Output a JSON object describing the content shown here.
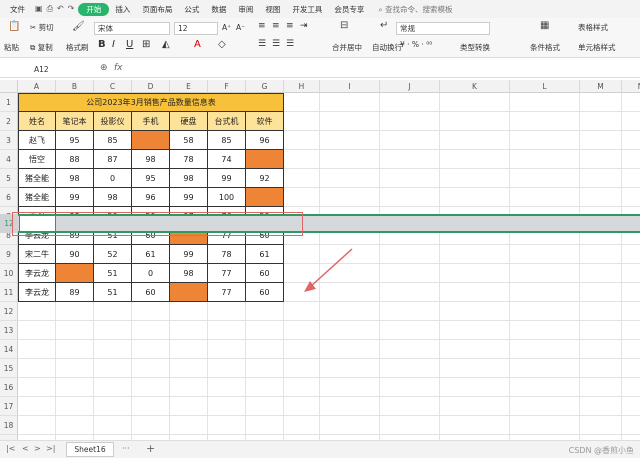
{
  "menu": {
    "file": "文件",
    "tabs": [
      "开始",
      "插入",
      "页面布局",
      "公式",
      "数据",
      "审阅",
      "视图",
      "开发工具",
      "会员专享"
    ],
    "active_index": 0,
    "search": "查找命令、搜索模板"
  },
  "ribbon": {
    "paste": "粘贴",
    "cut": "剪切",
    "copy": "复制",
    "format_painter": "格式刷",
    "font_name": "宋体",
    "font_size": "12",
    "merge_center": "合并居中",
    "wrap_text": "自动换行",
    "number_format": "常规",
    "type_convert": "类型转换",
    "conditional_format": "条件格式",
    "table_style": "表格样式",
    "cell_style": "单元格样式"
  },
  "formula_bar": {
    "name_box": "A12",
    "fx": "fx",
    "value": ""
  },
  "columns": [
    "A",
    "B",
    "C",
    "D",
    "E",
    "F",
    "G",
    "H",
    "I",
    "J",
    "K",
    "L",
    "M",
    "N",
    "O"
  ],
  "rows": [
    "1",
    "2",
    "3",
    "4",
    "5",
    "6",
    "7",
    "8",
    "9",
    "10",
    "11",
    "12",
    "13",
    "14",
    "15",
    "16",
    "17",
    "18",
    "19",
    "20"
  ],
  "table": {
    "title": "公司2023年3月销售产品数量信息表",
    "headers": [
      "姓名",
      "笔记本",
      "投影仪",
      "手机",
      "硬盘",
      "台式机",
      "软件"
    ],
    "rows": [
      [
        "赵飞",
        "95",
        "85",
        "",
        "58",
        "85",
        "96"
      ],
      [
        "悟空",
        "88",
        "87",
        "98",
        "78",
        "74",
        ""
      ],
      [
        "猪全能",
        "98",
        "0",
        "95",
        "98",
        "99",
        "92"
      ],
      [
        "猪全能",
        "99",
        "98",
        "96",
        "99",
        "100",
        ""
      ],
      [
        "王强",
        "88",
        "50",
        "59",
        "97",
        "76",
        "59"
      ],
      [
        "李云龙",
        "89",
        "51",
        "60",
        "",
        "77",
        "60"
      ],
      [
        "宋二牛",
        "90",
        "52",
        "61",
        "99",
        "78",
        "61"
      ],
      [
        "李云龙",
        "",
        "51",
        "0",
        "98",
        "77",
        "60"
      ],
      [
        "李云龙",
        "89",
        "51",
        "60",
        "",
        "77",
        "60"
      ]
    ],
    "highlight_color": "#ee8436"
  },
  "sheet": {
    "tab": "Sheet16",
    "add": "+"
  },
  "watermark": "CSDN @香煎小鱼"
}
